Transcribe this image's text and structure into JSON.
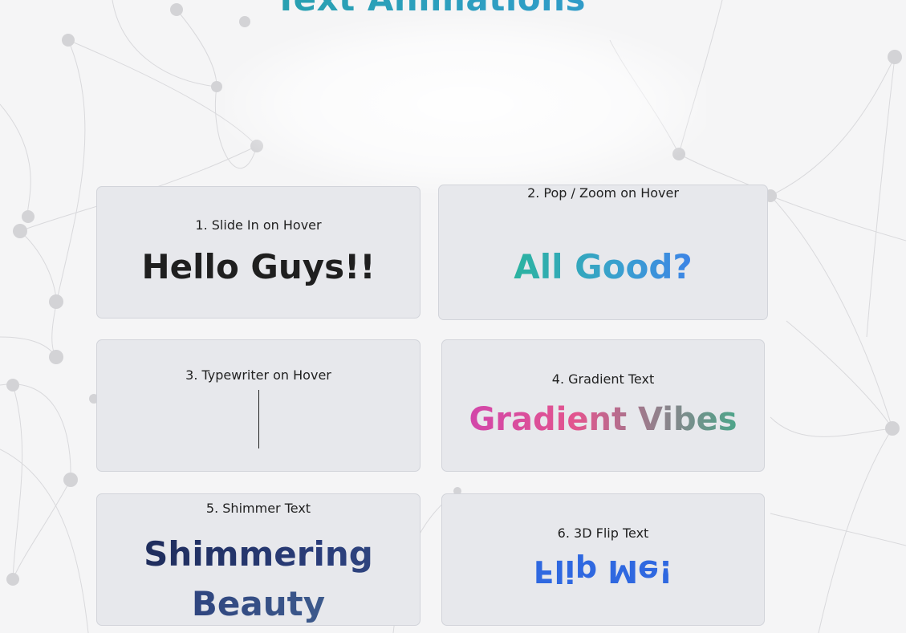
{
  "page": {
    "title": "Text Animations"
  },
  "cards": [
    {
      "heading": "1. Slide In on Hover",
      "demo_text": "Hello Guys!!"
    },
    {
      "heading": "2. Pop / Zoom on Hover",
      "demo_text": "All Good?"
    },
    {
      "heading": "3. Typewriter on Hover",
      "demo_text": ""
    },
    {
      "heading": "4. Gradient Text",
      "demo_text": "Gradient Vibes"
    },
    {
      "heading": "5. Shimmer Text",
      "demo_text": "Shimmering Beauty"
    },
    {
      "heading": "6. 3D Flip Text",
      "demo_text": "Flip Me!"
    }
  ],
  "colors": {
    "card_background": "#e7e8ec",
    "title_gradient": [
      "#22a39a",
      "#3a8fd8"
    ],
    "pop_gradient": [
      "#2bb3a0",
      "#3d84e6"
    ],
    "vibes_gradient": [
      "#d246aa",
      "#4da58a"
    ],
    "shimmer_gradient": [
      "#1f2d5c",
      "#3d5a8c"
    ],
    "flip_text": "#2f68e0"
  }
}
